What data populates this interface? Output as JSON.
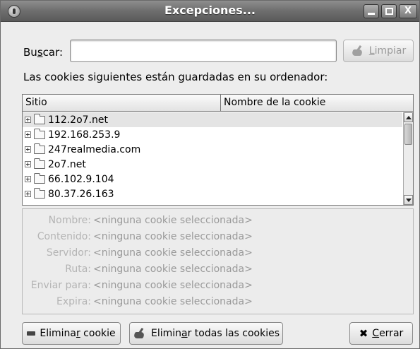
{
  "window": {
    "title": "Excepciones...",
    "controls": {
      "minimize": "_",
      "maximize": "□",
      "close": "X"
    }
  },
  "search": {
    "label_pre": "Bu",
    "label_key": "s",
    "label_post": "car:",
    "value": "",
    "clear_pre": "",
    "clear_key": "L",
    "clear_post": "impiar"
  },
  "info_text": "Las cookies siguientes están guardadas en su ordenador:",
  "table": {
    "columns": [
      "Sitio",
      "Nombre de la cookie"
    ],
    "rows": [
      {
        "site": "112.2o7.net",
        "cookie": "",
        "selected": true
      },
      {
        "site": "192.168.253.9",
        "cookie": ""
      },
      {
        "site": "247realmedia.com",
        "cookie": ""
      },
      {
        "site": "2o7.net",
        "cookie": ""
      },
      {
        "site": "66.102.9.104",
        "cookie": ""
      },
      {
        "site": "80.37.26.163",
        "cookie": ""
      }
    ]
  },
  "details": [
    {
      "label": "Nombre:",
      "value": "<ninguna cookie seleccionada>"
    },
    {
      "label": "Contenido:",
      "value": "<ninguna cookie seleccionada>"
    },
    {
      "label": "Servidor:",
      "value": "<ninguna cookie seleccionada>"
    },
    {
      "label": "Ruta:",
      "value": "<ninguna cookie seleccionada>"
    },
    {
      "label": "Enviar para:",
      "value": "<ninguna cookie seleccionada>"
    },
    {
      "label": "Expira:",
      "value": "<ninguna cookie seleccionada>"
    }
  ],
  "buttons": {
    "remove": {
      "pre": "Elimina",
      "key": "r",
      "post": " cookie"
    },
    "remove_all": {
      "pre": "Elimin",
      "key": "a",
      "post": "r todas las cookies"
    },
    "close": {
      "pre": "",
      "key": "C",
      "post": "errar"
    }
  },
  "colors": {
    "titlebar": "#6e6e6e",
    "window_bg": "#ededed",
    "selection": "#e4e4e4"
  }
}
